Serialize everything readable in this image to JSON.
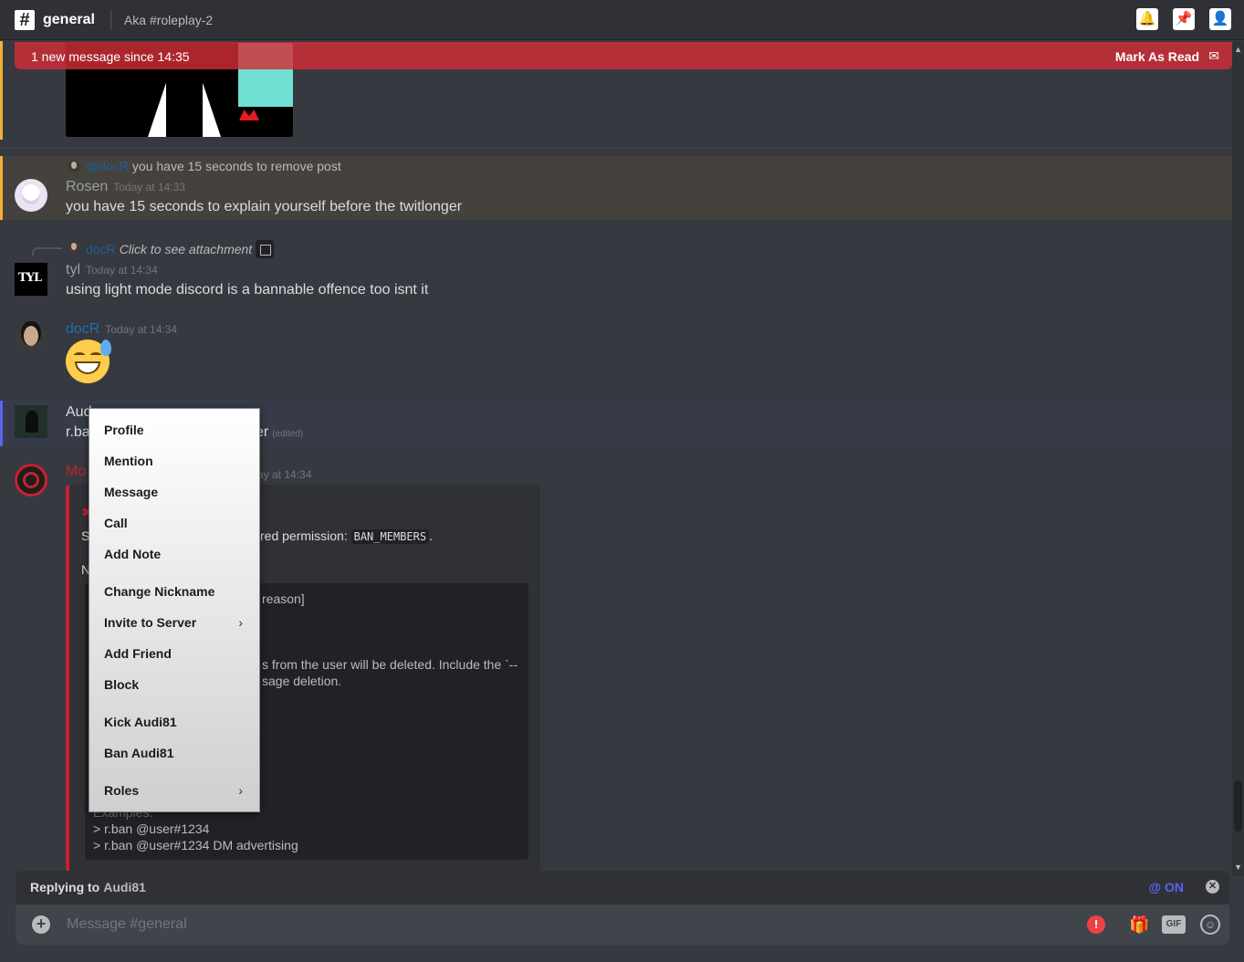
{
  "header": {
    "channel_symbol": "#",
    "channel_name": "general",
    "topic": "Aka #roleplay-2",
    "icons": [
      "bell-icon",
      "pin-icon",
      "members-icon"
    ]
  },
  "new_messages_bar": {
    "text": "1 new message since 14:35",
    "mark_read": "Mark As Read"
  },
  "messages": [
    {
      "reply": {
        "name": "@docR",
        "text": "you have 15 seconds to remove post"
      },
      "author": "Rosen",
      "author_color": "#9aa0a8",
      "timestamp": "Today at 14:33",
      "text": "you have 15 seconds to explain yourself before the twitlonger"
    },
    {
      "reply": {
        "name": "docR",
        "text": "Click to see attachment"
      },
      "author": "tyl",
      "author_color": "#9aa0a8",
      "timestamp": "Today at 14:34",
      "text": "using light mode discord is a bannable offence too isnt it"
    },
    {
      "author": "docR",
      "author_color": "#1e6eb0",
      "timestamp": "Today at 14:34",
      "emoji": "sweat-smile"
    },
    {
      "author": "Aud",
      "author_color": "#9aa0a8",
      "text_start": "r.ba",
      "text_end": "er",
      "edited": "(edited)"
    },
    {
      "author": "Mo",
      "author_color": "#c8202f",
      "timestamp": "ay at 14:34",
      "embed": {
        "line1_start": "S",
        "line1_end": "red permission:",
        "permission": "BAN_MEMBERS",
        "period": ".",
        "line2": "N",
        "code_lines": [
          "reason]",
          "s from the user will be deleted. Include the `--",
          "sage deletion.",
          "Examples:",
          "> r.ban @user#1234",
          "> r.ban @user#1234 DM advertising"
        ]
      }
    }
  ],
  "context_menu": {
    "items": [
      "Profile",
      "Mention",
      "Message",
      "Call",
      "Add Note",
      "Change Nickname",
      "Invite to Server",
      "Add Friend",
      "Block",
      "Kick Audi81",
      "Ban Audi81",
      "Roles"
    ]
  },
  "reply_bar": {
    "label": "Replying to",
    "target": "Audi81",
    "ping": "@ ON"
  },
  "composer": {
    "placeholder": "Message #general",
    "gif_label": "GIF",
    "alert_label": "!"
  }
}
